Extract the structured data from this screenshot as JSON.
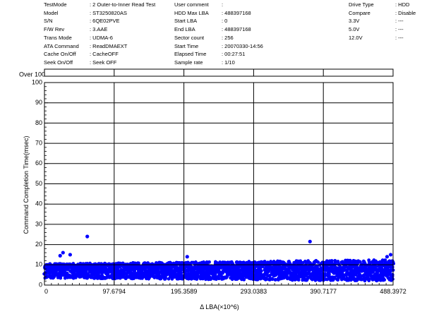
{
  "info": [
    {
      "label": "TestMode",
      "value": ": 2 Outer-to-Inner Read Test"
    },
    {
      "label": "Model",
      "value": ": ST3250820AS"
    },
    {
      "label": "S/N",
      "value": ":                6QE02PVE"
    },
    {
      "label": "F/W Rev",
      "value": ": 3.AAE"
    },
    {
      "label": "Trans Mode",
      "value": ": UDMA-6"
    },
    {
      "label": "ATA Command",
      "value": ": ReadDMAEXT"
    },
    {
      "label": "Cache On/Off",
      "value": ": CacheOFF"
    },
    {
      "label": "Seek On/Off",
      "value": ": Seek OFF"
    },
    {
      "label": "User comment",
      "value": ":"
    },
    {
      "label": "HDD Max LBA",
      "value": ": 488397168"
    },
    {
      "label": "Start LBA",
      "value": ": 0"
    },
    {
      "label": "End LBA",
      "value": ": 488397168"
    },
    {
      "label": "Sector count",
      "value": ": 256"
    },
    {
      "label": "Start Time",
      "value": ": 20070330-14:56"
    },
    {
      "label": "Elapsed Time",
      "value": ": 00:27:51"
    },
    {
      "label": "Sample rate",
      "value": ": 1/10"
    },
    {
      "label": "Drive Type",
      "value": ": HDD"
    },
    {
      "label": "Compare",
      "value": ": Disable"
    },
    {
      "label": "3.3V",
      "value": ": ---"
    },
    {
      "label": "5.0V",
      "value": ": ---"
    },
    {
      "label": "12.0V",
      "value": ": ---"
    }
  ],
  "colors": {
    "points": "#0000ff",
    "grid": "#000000",
    "background": "#ffffff"
  },
  "chart_data": {
    "type": "scatter",
    "title": "",
    "over_label": "Over 100",
    "xlabel": "Δ LBA(×10^6)",
    "ylabel": "Command Completion Time(msec)",
    "xlim": [
      0,
      488.3972
    ],
    "ylim": [
      0,
      100
    ],
    "x_ticks": [
      "0",
      "97.6794",
      "195.3589",
      "293.0383",
      "390.7177",
      "488.3972"
    ],
    "y_ticks": [
      "0",
      "10",
      "20",
      "30",
      "40",
      "50",
      "60",
      "70",
      "80",
      "90",
      "100"
    ],
    "grid": true,
    "band": {
      "x_start": 0,
      "x_end": 488.3972,
      "y_low_start": 3.5,
      "y_high_start": 10.5,
      "y_low_end": 2,
      "y_high_end": 12.5
    },
    "outliers": [
      {
        "x": 22,
        "y": 14.5
      },
      {
        "x": 26,
        "y": 16
      },
      {
        "x": 36,
        "y": 15
      },
      {
        "x": 60,
        "y": 24
      },
      {
        "x": 200,
        "y": 14
      },
      {
        "x": 372,
        "y": 21.5
      },
      {
        "x": 480,
        "y": 14
      },
      {
        "x": 485,
        "y": 15
      }
    ]
  }
}
